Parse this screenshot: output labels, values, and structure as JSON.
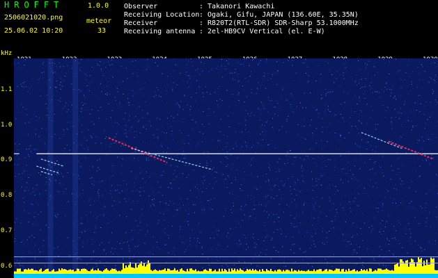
{
  "header": {
    "app_title": "HROFFT",
    "app_version": "1.0.0",
    "filename": "2506021020.png",
    "meteor_label": "meteor",
    "datetime": "25.06.02 10:20",
    "meteor_count": "33"
  },
  "info": [
    {
      "label": "Observer",
      "value": ": Takanori Kawachi"
    },
    {
      "label": "Receiving Location",
      "value": ": Ogaki, Gifu, JAPAN (136.60E, 35.35N)"
    },
    {
      "label": "Receiver",
      "value": ": R820T2(RTL-SDR) SDR-Sharp 53.1000MHz"
    },
    {
      "label": "Receiving antenna",
      "value": ": 2el-HB9CV Vertical (el. E-W)"
    }
  ],
  "chart_data": {
    "type": "heatmap",
    "ylabel": "kHz",
    "xticks": [
      "1021",
      "1022",
      "1023",
      "1024",
      "1025",
      "1026",
      "1027",
      "1028",
      "1029",
      "1030"
    ],
    "yticks": [
      "1.1",
      "1.0",
      "0.9",
      "0.8",
      "0.7",
      "0.6"
    ],
    "xlim": [
      1020.6,
      1030
    ],
    "ylim": [
      0.58,
      1.19
    ],
    "carrier_khz": 0.92,
    "colors": {
      "background": "#0b1a5e",
      "signal": "#ffffff",
      "strong": "#ff3060",
      "histogram": "#ffff00",
      "strip": "#00c8ff"
    }
  }
}
